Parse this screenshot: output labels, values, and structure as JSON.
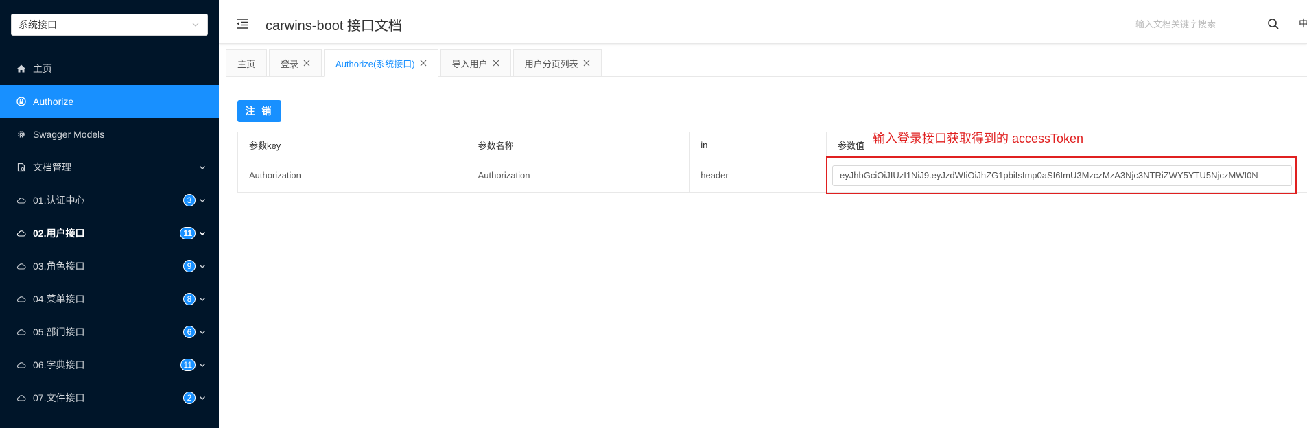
{
  "sidebar": {
    "selector_value": "系统接口",
    "items": [
      {
        "label": "主页",
        "icon": "home-icon"
      },
      {
        "label": "Authorize",
        "icon": "lock-icon"
      },
      {
        "label": "Swagger Models",
        "icon": "gear-icon"
      },
      {
        "label": "文档管理",
        "icon": "document-icon"
      },
      {
        "label": "01.认证中心",
        "icon": "cloud-icon",
        "badge": "3"
      },
      {
        "label": "02.用户接口",
        "icon": "cloud-icon",
        "badge": "11"
      },
      {
        "label": "03.角色接口",
        "icon": "cloud-icon",
        "badge": "9"
      },
      {
        "label": "04.菜单接口",
        "icon": "cloud-icon",
        "badge": "8"
      },
      {
        "label": "05.部门接口",
        "icon": "cloud-icon",
        "badge": "6"
      },
      {
        "label": "06.字典接口",
        "icon": "cloud-icon",
        "badge": "11"
      },
      {
        "label": "07.文件接口",
        "icon": "cloud-icon",
        "badge": "2"
      }
    ]
  },
  "header": {
    "title": "carwins-boot 接口文档",
    "search_placeholder": "输入文档关键字搜索",
    "lang": "中"
  },
  "tabs": [
    {
      "label": "主页"
    },
    {
      "label": "登录"
    },
    {
      "label": "Authorize(系统接口)"
    },
    {
      "label": "导入用户"
    },
    {
      "label": "用户分页列表"
    }
  ],
  "main": {
    "logout_label": "注 销",
    "annotation": "输入登录接口获取得到的 accessToken",
    "table": {
      "headers": [
        "参数key",
        "参数名称",
        "in",
        "参数值"
      ],
      "row": [
        "Authorization",
        "Authorization",
        "header"
      ],
      "token_value": "eyJhbGciOiJIUzI1NiJ9.eyJzdWIiOiJhZG1pbiIsImp0aSI6ImU3MzczMzA3Njc3NTRiZWY5YTU5NjczMWI0N"
    }
  },
  "colors": {
    "sidebar_bg": "#001529",
    "accent": "#1890ff",
    "annotation": "#e02020"
  }
}
